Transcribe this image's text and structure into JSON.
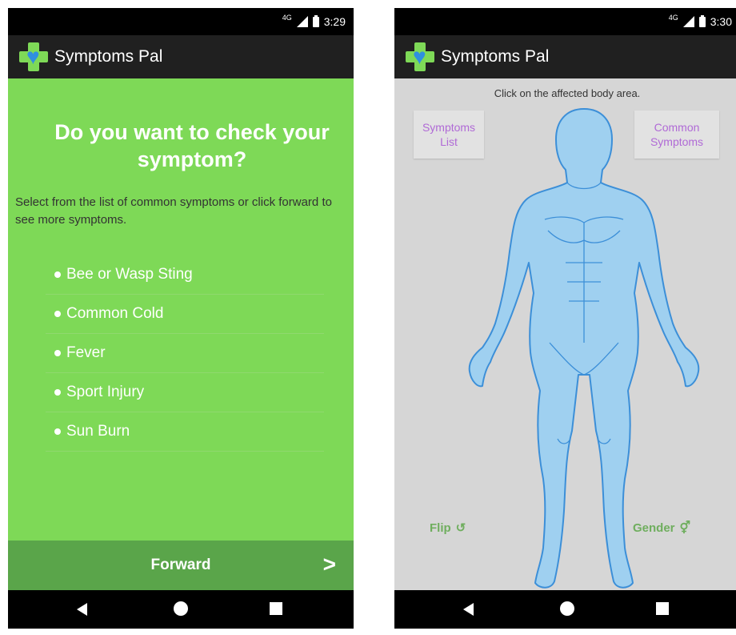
{
  "left_screen": {
    "status": {
      "network": "4G",
      "time": "3:29"
    },
    "app_title": "Symptoms Pal",
    "question": "Do you want to check your symptom?",
    "instruction": "Select from the list of common symptoms or click forward to see more symptoms.",
    "symptoms": [
      "Bee or Wasp Sting",
      "Common Cold",
      "Fever",
      "Sport Injury",
      "Sun Burn"
    ],
    "forward_label": "Forward",
    "forward_icon": ">"
  },
  "right_screen": {
    "status": {
      "network": "4G",
      "time": "3:30"
    },
    "app_title": "Symptoms Pal",
    "hint": "Click on the affected body area.",
    "symptoms_list_label": "Symptoms List",
    "common_symptoms_label": "Common Symptoms",
    "flip_label": "Flip",
    "flip_icon": "↺",
    "gender_label": "Gender",
    "gender_icon": "⚥"
  },
  "colors": {
    "green_background": "#7ed957",
    "forward_bar": "#5aa54a",
    "app_bar": "#202020",
    "purple_text": "#b06ad6",
    "body_blue": "#9fd0f0",
    "body_outline": "#3c8fd8"
  },
  "icons": [
    "logo-cross-heart-icon",
    "signal-icon",
    "battery-icon",
    "back-icon",
    "home-icon",
    "recents-icon",
    "chevron-right-icon",
    "flip-icon",
    "gender-icon"
  ]
}
